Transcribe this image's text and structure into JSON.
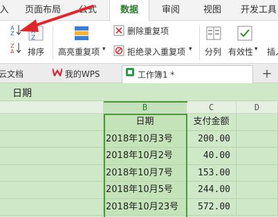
{
  "menubar": {
    "items": [
      "入",
      "页面布局",
      "公式",
      "数据",
      "审阅",
      "视图",
      "开发工具"
    ],
    "active_index": 3
  },
  "ribbon": {
    "sort_label": "排序",
    "highlight_dup_label": "高亮重复项",
    "remove_dup_label": "删除重复项",
    "reject_dup_label": "拒绝录入重复项",
    "split_label": "分列",
    "validity_label": "有效性",
    "insert_label": "插入",
    "dropdown_glyph": "▾",
    "accent_color": "#4a9b35",
    "arrow_color": "#e0262b"
  },
  "doc_tabs": {
    "tabs": [
      "云文档",
      "我的WPS",
      "工作簿1 *"
    ],
    "add_glyph": "+",
    "close_glyph": "✕"
  },
  "formula_bar": {
    "content": "日期"
  },
  "sheet": {
    "columns": [
      "B",
      "C",
      "D"
    ],
    "header_row": {
      "b": "日期",
      "c": "支付金额"
    },
    "rows": [
      {
        "b": "2018年10月3号",
        "c": "200.00"
      },
      {
        "b": "2018年10月2号",
        "c": "40.00"
      },
      {
        "b": "2018年10月7号",
        "c": "153.00"
      },
      {
        "b": "2018年10月5号",
        "c": "244.00"
      },
      {
        "b": "2018年10月23号",
        "c": "572.00"
      }
    ]
  }
}
